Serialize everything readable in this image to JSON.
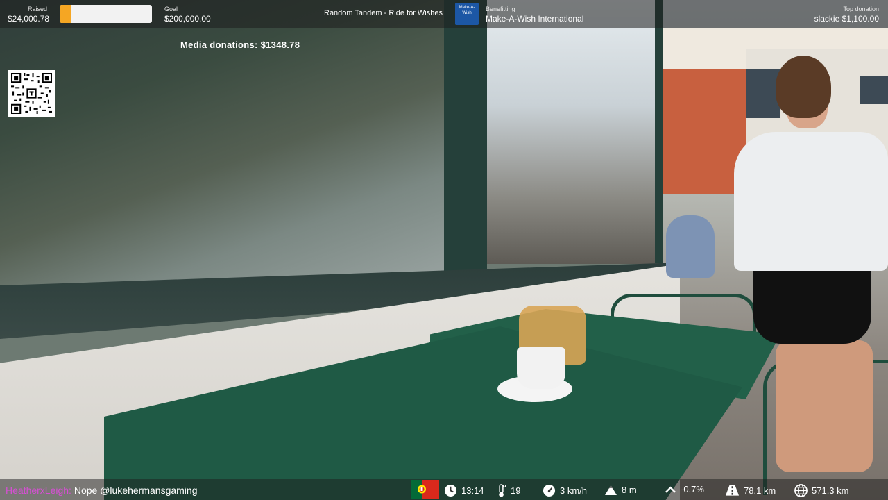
{
  "stream": {
    "raised_label": "Raised",
    "raised_value": "$24,000.78",
    "goal_label": "Goal",
    "goal_value": "$200,000.00",
    "progress_fraction": 0.12,
    "event_title": "Random Tandem - Ride for Wishes",
    "benefitting_label": "Benefitting",
    "charity_name": "Make-A-Wish International",
    "charity_logo_text": "Make-A-Wish",
    "top_donation_label": "Top donation",
    "top_donation_value": "slackie $1,100.00",
    "media_donations": "Media donations: $1348.78"
  },
  "chat": {
    "username": "HeatherxLeigh:",
    "message": "Nope @lukehermansgaming"
  },
  "stats": {
    "country_flag": "portugal-flag",
    "time": "13:14",
    "temperature": "19",
    "speed": "3 km/h",
    "altitude": "8 m",
    "gradient": "-0.7%",
    "day_distance": "78.1 km",
    "total_distance": "571.3 km"
  },
  "colors": {
    "progress_fill": "#f5a623",
    "progress_track": "#f2f2f2",
    "chat_username": "#d74fd5",
    "charity_blue": "#1c57a5"
  }
}
